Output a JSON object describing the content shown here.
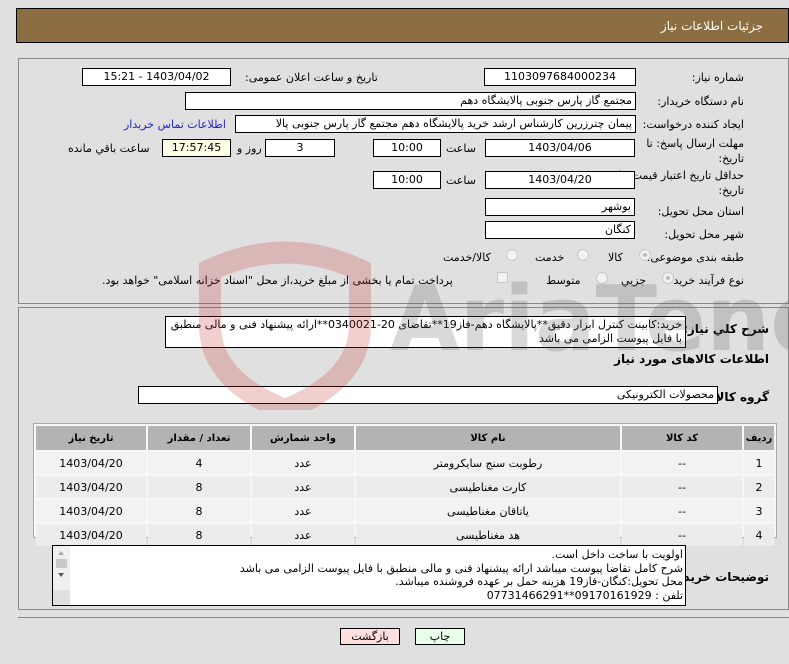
{
  "header": {
    "title": "جزئیات اطلاعات نیاز"
  },
  "form": {
    "need_number_label": "شماره نیاز:",
    "need_number": "1103097684000234",
    "announce_label": "تاریخ و ساعت اعلان عمومی:",
    "announce_value": "1403/04/02 - 15:21",
    "buyer_org_label": "نام دستگاه خریدار:",
    "buyer_org": "مجتمع گاز پارس جنوبی  پالایشگاه دهم",
    "creator_label": "ایجاد کننده درخواست:",
    "creator": "پیمان چترزرین کارشناس ارشد خرید پالایشگاه دهم مجتمع گاز پارس جنوبی  پالا",
    "contact_link": "اطلاعات تماس خریدار",
    "reply_deadline_label_1": "مهلت ارسال پاسخ: تا",
    "reply_deadline_label_2": "تاریخ:",
    "reply_date": "1403/04/06",
    "time_label": "ساعت",
    "reply_time": "10:00",
    "days_value": "3",
    "days_label": "روز و",
    "remaining_time": "17:57:45",
    "remaining_label": "ساعت باقي مانده",
    "price_validity_label_1": "حداقل تاریخ اعتبار قیمت: تا",
    "price_validity_label_2": "تاریخ:",
    "price_date": "1403/04/20",
    "price_time": "10:00",
    "province_label": "استان محل تحویل:",
    "province": "بوشهر",
    "city_label": "شهر محل تحویل:",
    "city": "کنگان",
    "category_label": "طبقه بندی موضوعی:",
    "category_options": [
      "کالا",
      "خدمت",
      "کالا/خدمت"
    ],
    "category_selected": "کالا",
    "process_label": "نوع فرآیند خرید :",
    "process_options": [
      "جزیي",
      "متوسط"
    ],
    "process_selected": "جزیي",
    "payment_note": "پرداخت تمام یا بخشی از مبلغ خرید،از محل \"اسناد خزانه اسلامی\" خواهد بود."
  },
  "description": {
    "label": "شرح کلي نياز:",
    "text": "خرید:کابینت کنترل ابزار دقیق**پالایشگاه دهم-فاز19**تقاضای 20-0340021**ارائه پیشنهاد فنی و مالی منطبق با فایل پیوست الزامی می باشد"
  },
  "goods": {
    "section_title": "اطلاعات کالاهای مورد نیاز",
    "group_label": "گروه کالا:",
    "group_value": "محصولات الکترونیکی",
    "columns": [
      "ردیف",
      "کد کالا",
      "نام کالا",
      "واحد شمارش",
      "تعداد / مقدار",
      "تاریخ نیاز"
    ],
    "rows": [
      {
        "row": "1",
        "code": "--",
        "name": "رطوبت سنج سایکرومتر",
        "unit": "عدد",
        "qty": "4",
        "date": "1403/04/20"
      },
      {
        "row": "2",
        "code": "--",
        "name": "کارت مغناطیسی",
        "unit": "عدد",
        "qty": "8",
        "date": "1403/04/20"
      },
      {
        "row": "3",
        "code": "--",
        "name": "یاتاقان مغناطیسی",
        "unit": "عدد",
        "qty": "8",
        "date": "1403/04/20"
      },
      {
        "row": "4",
        "code": "--",
        "name": "هد مغناطیسی",
        "unit": "عدد",
        "qty": "8",
        "date": "1403/04/20"
      }
    ]
  },
  "buyer_notes": {
    "label": "توضیحات خریدار:",
    "lines": [
      "اولویت با ساخت داخل است.",
      "شرح کامل تقاضا پیوست میباشد ارائه پیشنهاد فنی و مالی منطبق با فایل پیوست الزامی می باشد",
      "محل تحویل:کنگان-فاز19 هزینه حمل بر عهده فروشنده میباشد.",
      "تلفن : 09170161929**07731466291"
    ]
  },
  "buttons": {
    "print": "چاپ",
    "back": "بازگشت"
  },
  "colors": {
    "header_bg": "#8d6d42",
    "print_bg": "#eaffea",
    "back_bg": "#ffe0e0",
    "link": "#2222cc"
  }
}
